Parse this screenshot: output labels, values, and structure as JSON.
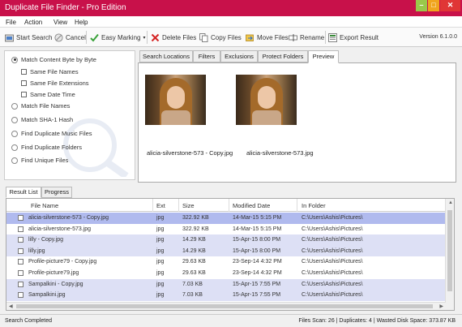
{
  "window": {
    "title": "Duplicate File Finder - Pro Edition"
  },
  "menu": {
    "file": "File",
    "action": "Action",
    "view": "View",
    "help": "Help"
  },
  "toolbar": {
    "start": "Start Search",
    "cancel": "Cancel",
    "easy_marking": "Easy Marking",
    "delete": "Delete Files",
    "copy": "Copy Files",
    "move": "Move Files",
    "rename": "Rename",
    "export": "Export Result",
    "version": "Version 6.1.0.0"
  },
  "options": {
    "match_content": "Match Content Byte by Byte",
    "same_names": "Same File Names",
    "same_ext": "Same File Extensions",
    "same_date": "Same Date Time",
    "match_names": "Match File Names",
    "match_sha": "Match SHA-1 Hash",
    "dup_music": "Find Duplicate Music Files",
    "dup_folders": "Find Duplicate Folders",
    "unique": "Find Unique Files"
  },
  "tabs": {
    "search_locations": "Search Locations",
    "filters": "Filters",
    "exclusions": "Exclusions",
    "protect": "Protect Folders",
    "preview": "Preview"
  },
  "preview": {
    "images": [
      {
        "caption": "alicia-silverstone-573 - Copy.jpg"
      },
      {
        "caption": "alicia-silverstone-573.jpg"
      }
    ]
  },
  "bottom_tabs": {
    "result_list": "Result List",
    "progress": "Progress"
  },
  "grid": {
    "columns": [
      "File Name",
      "Ext",
      "Size",
      "Modified Date",
      "In Folder"
    ],
    "rows": [
      {
        "name": "alicia-silverstone-573 - Copy.jpg",
        "ext": "jpg",
        "size": "322.92 KB",
        "date": "14-Mar-15 5:15 PM",
        "folder": "C:\\Users\\Ashis\\Pictures\\"
      },
      {
        "name": "alicia-silverstone-573.jpg",
        "ext": "jpg",
        "size": "322.92 KB",
        "date": "14-Mar-15 5:15 PM",
        "folder": "C:\\Users\\Ashis\\Pictures\\"
      },
      {
        "name": "lilly - Copy.jpg",
        "ext": "jpg",
        "size": "14.29 KB",
        "date": "15-Apr-15 8:00 PM",
        "folder": "C:\\Users\\Ashis\\Pictures\\"
      },
      {
        "name": "lilly.jpg",
        "ext": "jpg",
        "size": "14.29 KB",
        "date": "15-Apr-15 8:00 PM",
        "folder": "C:\\Users\\Ashis\\Pictures\\"
      },
      {
        "name": "Profile-picture79 - Copy.jpg",
        "ext": "jpg",
        "size": "29.63 KB",
        "date": "23-Sep-14 4:32 PM",
        "folder": "C:\\Users\\Ashis\\Pictures\\"
      },
      {
        "name": "Profile-picture79.jpg",
        "ext": "jpg",
        "size": "29.63 KB",
        "date": "23-Sep-14 4:32 PM",
        "folder": "C:\\Users\\Ashis\\Pictures\\"
      },
      {
        "name": "Sampalkini - Copy.jpg",
        "ext": "jpg",
        "size": "7.03 KB",
        "date": "15-Apr-15 7:55 PM",
        "folder": "C:\\Users\\Ashis\\Pictures\\"
      },
      {
        "name": "Sampalkini.jpg",
        "ext": "jpg",
        "size": "7.03 KB",
        "date": "15-Apr-15 7:55 PM",
        "folder": "C:\\Users\\Ashis\\Pictures\\"
      }
    ]
  },
  "status": {
    "left": "Search Completed",
    "right": "Files Scan: 26 | Duplicates: 4 | Wasted Disk Space: 373.87 KB"
  },
  "colors": {
    "title_bar": "#c8114a",
    "selected_row": "#b0baee",
    "alt_row": "#dde0f5"
  }
}
